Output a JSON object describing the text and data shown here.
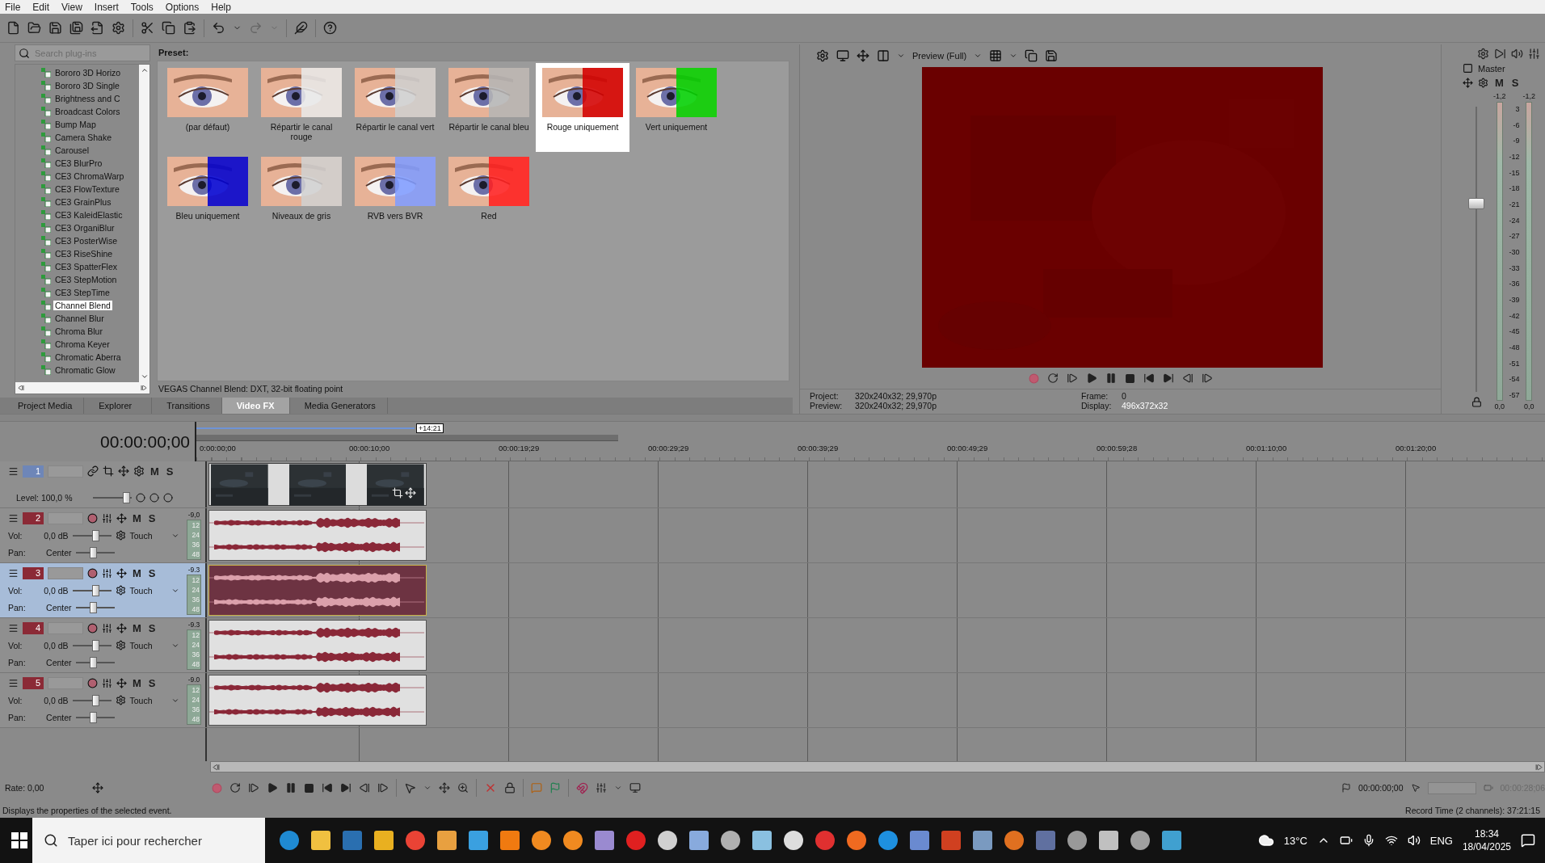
{
  "menu": [
    "File",
    "Edit",
    "View",
    "Insert",
    "Tools",
    "Options",
    "Help"
  ],
  "plugins": {
    "search": {
      "placeholder": "Search plug-ins"
    },
    "items": [
      {
        "label": "Bororo 3D Horizo",
        "selected": false
      },
      {
        "label": "Bororo 3D Single",
        "selected": false
      },
      {
        "label": "Brightness and C",
        "selected": false
      },
      {
        "label": "Broadcast Colors",
        "selected": false
      },
      {
        "label": "Bump Map",
        "selected": false
      },
      {
        "label": "Camera Shake",
        "selected": false
      },
      {
        "label": "Carousel",
        "selected": false
      },
      {
        "label": "CE3 BlurPro",
        "selected": false
      },
      {
        "label": "CE3 ChromaWarp",
        "selected": false
      },
      {
        "label": "CE3 FlowTexture",
        "selected": false
      },
      {
        "label": "CE3 GrainPlus",
        "selected": false
      },
      {
        "label": "CE3 KaleidElastic",
        "selected": false
      },
      {
        "label": "CE3 OrganiBlur",
        "selected": false
      },
      {
        "label": "CE3 PosterWise",
        "selected": false
      },
      {
        "label": "CE3 RiseShine",
        "selected": false
      },
      {
        "label": "CE3 SpatterFlex",
        "selected": false
      },
      {
        "label": "CE3 StepMotion",
        "selected": false
      },
      {
        "label": "CE3 StepTime",
        "selected": false
      },
      {
        "label": "Channel Blend",
        "selected": true
      },
      {
        "label": "Channel Blur",
        "selected": false
      },
      {
        "label": "Chroma Blur",
        "selected": false
      },
      {
        "label": "Chroma Keyer",
        "selected": false
      },
      {
        "label": "Chromatic Aberra",
        "selected": false
      },
      {
        "label": "Chromatic Glow",
        "selected": false
      }
    ]
  },
  "presets": {
    "heading": "Preset:",
    "items": [
      {
        "label": "(par défaut)",
        "selected": false
      },
      {
        "label": "Répartir le canal rouge",
        "selected": false
      },
      {
        "label": "Répartir le canal vert",
        "selected": false
      },
      {
        "label": "Répartir le canal bleu",
        "selected": false
      },
      {
        "label": "Rouge uniquement",
        "selected": true
      },
      {
        "label": "Vert uniquement",
        "selected": false
      },
      {
        "label": "Bleu uniquement",
        "selected": false
      },
      {
        "label": "Niveaux de gris",
        "selected": false
      },
      {
        "label": "RVB vers BVR",
        "selected": false
      },
      {
        "label": "Red",
        "selected": false
      }
    ],
    "description": "VEGAS Channel Blend: DXT, 32-bit floating point"
  },
  "dock_tabs": [
    {
      "label": "Project Media",
      "selected": false
    },
    {
      "label": "Explorer",
      "selected": false
    },
    {
      "label": "Transitions",
      "selected": false
    },
    {
      "label": "Video FX",
      "selected": true
    },
    {
      "label": "Media Generators",
      "selected": false
    }
  ],
  "preview": {
    "quality": "Preview (Full)",
    "project_label": "Project:",
    "project": "320x240x32; 29,970p",
    "preview_label": "Preview:",
    "preview": "320x240x32; 29,970p",
    "frame_label": "Frame:",
    "frame": "0",
    "display_label": "Display:",
    "display": "496x372x32"
  },
  "master": {
    "title": "Master",
    "mute": "M",
    "solo": "S",
    "peaks": [
      "-1,2",
      "-1,2"
    ],
    "scale": [
      "3",
      "-6",
      "-9",
      "-12",
      "-15",
      "-18",
      "-21",
      "-24",
      "-27",
      "-30",
      "-33",
      "-36",
      "-39",
      "-42",
      "-45",
      "-48",
      "-51",
      "-54",
      "-57"
    ],
    "readings": [
      "0,0",
      "0,0"
    ],
    "level": 0.66
  },
  "timeline": {
    "timecode": "00:00:00;00",
    "loop_length": "+14:21",
    "ruler": [
      "0:00:00;00",
      "00:00:10;00",
      "00:00:19;29",
      "00:00:29;29",
      "00:00:39;29",
      "00:00:49;29",
      "00:00:59;28",
      "00:01:10;00",
      "00:01:20;00"
    ],
    "tracks": [
      {
        "kind": "video",
        "number": "1",
        "selected": false,
        "mute": "M",
        "solo": "S",
        "level_label": "Level: 100,0 %",
        "level": 0.85
      },
      {
        "kind": "audio",
        "number": "2",
        "selected": false,
        "mute": "M",
        "solo": "S",
        "peak": "-9,0",
        "vol": {
          "label": "Vol:",
          "value": "0,0 dB",
          "level": 0.6
        },
        "pan": {
          "label": "Pan:",
          "value": "Center",
          "level": 0.45
        },
        "automation": "Touch",
        "meter": [
          "12",
          "24",
          "36",
          "48"
        ]
      },
      {
        "kind": "audio",
        "number": "3",
        "selected": true,
        "mute": "M",
        "solo": "S",
        "peak": "-9.3",
        "vol": {
          "label": "Vol:",
          "value": "0,0 dB",
          "level": 0.6
        },
        "pan": {
          "label": "Pan:",
          "value": "Center",
          "level": 0.45
        },
        "automation": "Touch",
        "meter": [
          "12",
          "24",
          "36",
          "48"
        ]
      },
      {
        "kind": "audio",
        "number": "4",
        "selected": false,
        "mute": "M",
        "solo": "S",
        "peak": "-9.3",
        "vol": {
          "label": "Vol:",
          "value": "0,0 dB",
          "level": 0.6
        },
        "pan": {
          "label": "Pan:",
          "value": "Center",
          "level": 0.45
        },
        "automation": "Touch",
        "meter": [
          "12",
          "24",
          "36",
          "48"
        ]
      },
      {
        "kind": "audio",
        "number": "5",
        "selected": false,
        "mute": "M",
        "solo": "S",
        "peak": "-9.0",
        "vol": {
          "label": "Vol:",
          "value": "0,0 dB",
          "level": 0.6
        },
        "pan": {
          "label": "Pan:",
          "value": "Center",
          "level": 0.45
        },
        "automation": "Touch",
        "meter": [
          "12",
          "24",
          "36",
          "48"
        ]
      }
    ]
  },
  "transport": {
    "rate": "Rate: 0,00",
    "cursor_time": "00:00:00;00",
    "length_time": "00:00:28;06"
  },
  "status_bar": {
    "message": "Displays the properties of the selected event.",
    "record_time": "Record Time (2 channels): 37:21:15"
  },
  "taskbar": {
    "search": {
      "placeholder": "Taper ici pour rechercher"
    },
    "temperature": "13°C",
    "language": "ENG",
    "time": "18:34",
    "date": "18/04/2025"
  }
}
